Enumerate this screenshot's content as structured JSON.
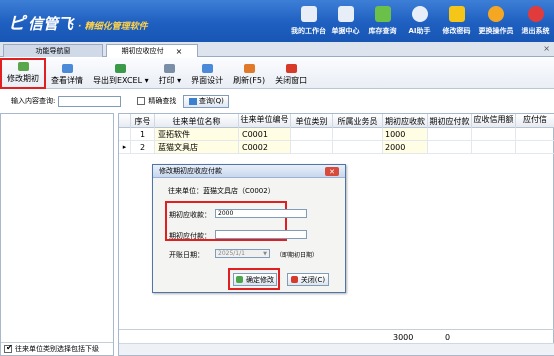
{
  "app": {
    "logo_mark": "ピ",
    "name": "信管飞",
    "subtitle": "· 精细化管理软件"
  },
  "top_nav": [
    {
      "label": "我的工作台",
      "icon": "monitor-icon",
      "color": "#e8eef8"
    },
    {
      "label": "单据中心",
      "icon": "document-icon",
      "color": "#e8eef8"
    },
    {
      "label": "库存查询",
      "icon": "chart-icon",
      "color": "#6bc04a"
    },
    {
      "label": "AI助手",
      "icon": "info-icon",
      "color": "#e8eef8"
    },
    {
      "label": "修改密码",
      "icon": "lock-icon",
      "color": "#f5c518"
    },
    {
      "label": "更换操作员",
      "icon": "user-icon",
      "color": "#f5a623"
    },
    {
      "label": "退出系统",
      "icon": "exit-icon",
      "color": "#e23b3b"
    }
  ],
  "tabs": [
    {
      "label": "功能导航窗"
    },
    {
      "label": "期初应收应付",
      "close": "×"
    }
  ],
  "close_all": "×",
  "toolbar": [
    {
      "label": "修改期初",
      "icon": "edit-icon",
      "color": "#5aa64a"
    },
    {
      "label": "查看详情",
      "icon": "detail-icon",
      "color": "#4a8ad8"
    },
    {
      "label": "导出到EXCEL ▾",
      "icon": "excel-icon",
      "color": "#3a9a4a"
    },
    {
      "label": "打印 ▾",
      "icon": "print-icon",
      "color": "#7a8ea8"
    },
    {
      "label": "界面设计",
      "icon": "design-icon",
      "color": "#4a8ad8"
    },
    {
      "label": "刷新(F5)",
      "icon": "refresh-icon",
      "color": "#e07a2a"
    },
    {
      "label": "关闭窗口",
      "icon": "close-window-icon",
      "color": "#d83a2a"
    }
  ],
  "query": {
    "label": "输入内容查询:",
    "value": "",
    "exact_label": "精确查找",
    "button": "查询(Q)"
  },
  "left_footer": "往来单位类别选择包括下级",
  "grid": {
    "columns": [
      "序号",
      "往来单位名称",
      "往来单位编号",
      "单位类别",
      "所属业务员",
      "期初应收款",
      "期初应付款",
      "应收信用额",
      "应付信"
    ],
    "rows": [
      {
        "idx": "1",
        "name": "亚拓软件",
        "code": "C0001",
        "recv": "1000"
      },
      {
        "idx": "2",
        "name": "蓝猫文具店",
        "code": "C0002",
        "recv": "2000"
      }
    ],
    "current_marker": "▸",
    "footer": {
      "recv_total": "3000",
      "pay_total": "0"
    }
  },
  "dialog": {
    "title": "修改期初应收应付款",
    "close": "✕",
    "unit_line": "往来单位：蓝猫文具店（C0002）",
    "recv_label": "期初应收款：",
    "recv_value": "2000",
    "pay_label": "期初应付款：",
    "pay_value": "",
    "date_label": "开账日期：",
    "date_value": "2025/1/1",
    "date_note": "（即期初日期）",
    "ok": "确定修改",
    "close_btn": "关闭(C)"
  }
}
